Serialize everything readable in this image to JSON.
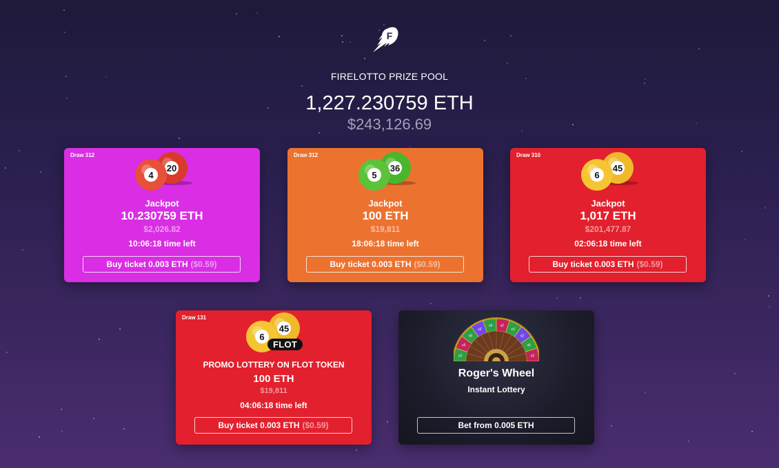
{
  "header": {
    "logo_letter": "F",
    "title": "FIRELOTTO PRIZE POOL",
    "pool_eth": "1,227.230759 ETH",
    "pool_usd": "$243,126.69"
  },
  "cards": [
    {
      "draw": "Draw 312",
      "balls": [
        "4",
        "20"
      ],
      "ball_colors": [
        "#e8503a",
        "#d93a2b"
      ],
      "label": "Jackpot",
      "eth": "10.230759 ETH",
      "usd": "$2,026.82",
      "time": "10:06:18 time left",
      "button_main": "Buy ticket 0.003 ETH",
      "button_usd": "($0.59)",
      "color": "#d92ee3"
    },
    {
      "draw": "Draw 312",
      "balls": [
        "5",
        "36"
      ],
      "ball_colors": [
        "#5cc23a",
        "#4ab62c"
      ],
      "label": "Jackpot",
      "eth": "100 ETH",
      "usd": "$19,811",
      "time": "18:06:18 time left",
      "button_main": "Buy ticket 0.003 ETH",
      "button_usd": "($0.59)",
      "color": "#ec7230"
    },
    {
      "draw": "Draw 310",
      "balls": [
        "6",
        "45"
      ],
      "ball_colors": [
        "#f5c533",
        "#f0b92a"
      ],
      "label": "Jackpot",
      "eth": "1,017 ETH",
      "usd": "$201,477.87",
      "time": "02:06:18 time left",
      "button_main": "Buy ticket 0.003 ETH",
      "button_usd": "($0.59)",
      "color": "#e3202d"
    }
  ],
  "promo": {
    "draw": "Draw 131",
    "balls": [
      "6",
      "45"
    ],
    "badge": "FLOT",
    "title": "PROMO LOTTERY ON FLOT TOKEN",
    "eth": "100 ETH",
    "usd": "$19,811",
    "time": "04:06:18 time left",
    "button_main": "Buy ticket 0.003 ETH",
    "button_usd": "($0.59)",
    "color": "#e3202d"
  },
  "wheel": {
    "title": "Roger's Wheel",
    "subtitle": "Instant Lottery",
    "button": "Bet from 0.005 ETH",
    "segment_labels": [
      "x2",
      "x3",
      "x5",
      "x2",
      "x4",
      "x2",
      "x3",
      "x2",
      "x5",
      "x2"
    ]
  },
  "icons": {
    "logo": "fire-rocket-icon",
    "wheel": "roulette-wheel-icon"
  }
}
